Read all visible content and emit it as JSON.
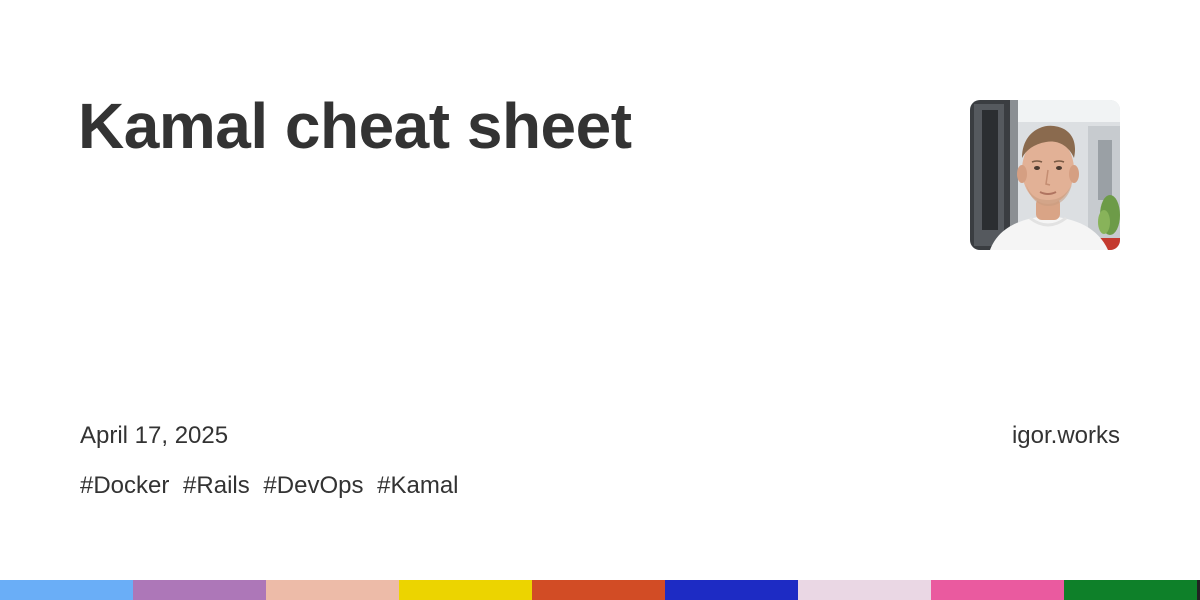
{
  "title": "Kamal cheat sheet",
  "date": "April 17, 2025",
  "site": "igor.works",
  "tags": [
    "#Docker",
    "#Rails",
    "#DevOps",
    "#Kamal"
  ],
  "avatar": {
    "icon": "author-photo"
  },
  "stripe_colors": [
    "#6aaef7",
    "#ad77b8",
    "#edbba8",
    "#ecd400",
    "#d24c25",
    "#1d2bc4",
    "#ead7e4",
    "#ea5a9f",
    "#0e8029",
    "#222222"
  ]
}
